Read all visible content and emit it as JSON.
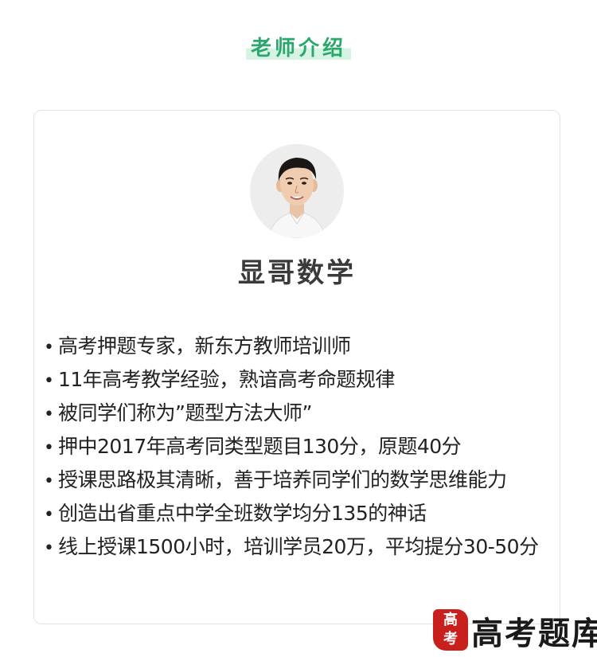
{
  "section": {
    "title": "老师介绍"
  },
  "teacher": {
    "name": "显哥数学",
    "bullet_symbol": "•",
    "bullets": [
      "高考押题专家，新东方教师培训师",
      "11年高考教学经验，熟谙高考命题规律",
      "被同学们称为”题型方法大师”",
      "押中2017年高考同类型题目130分，原题40分",
      "授课思路极其清晰，善于培养同学们的数学思维能力",
      "创造出省重点中学全班数学均分135的神话",
      "线上授课1500小时，培训学员20万，平均提分30-50分"
    ]
  },
  "watermark": {
    "text": "高考题库",
    "seal_text": "高考"
  },
  "colors": {
    "accent": "#2aa86b",
    "accent_highlight": "#d6f3e3",
    "card_border": "#e3e3e3",
    "seal": "#c8201d"
  },
  "icons": {
    "avatar": "teacher-portrait",
    "bullet": "bullet-dot-icon"
  }
}
